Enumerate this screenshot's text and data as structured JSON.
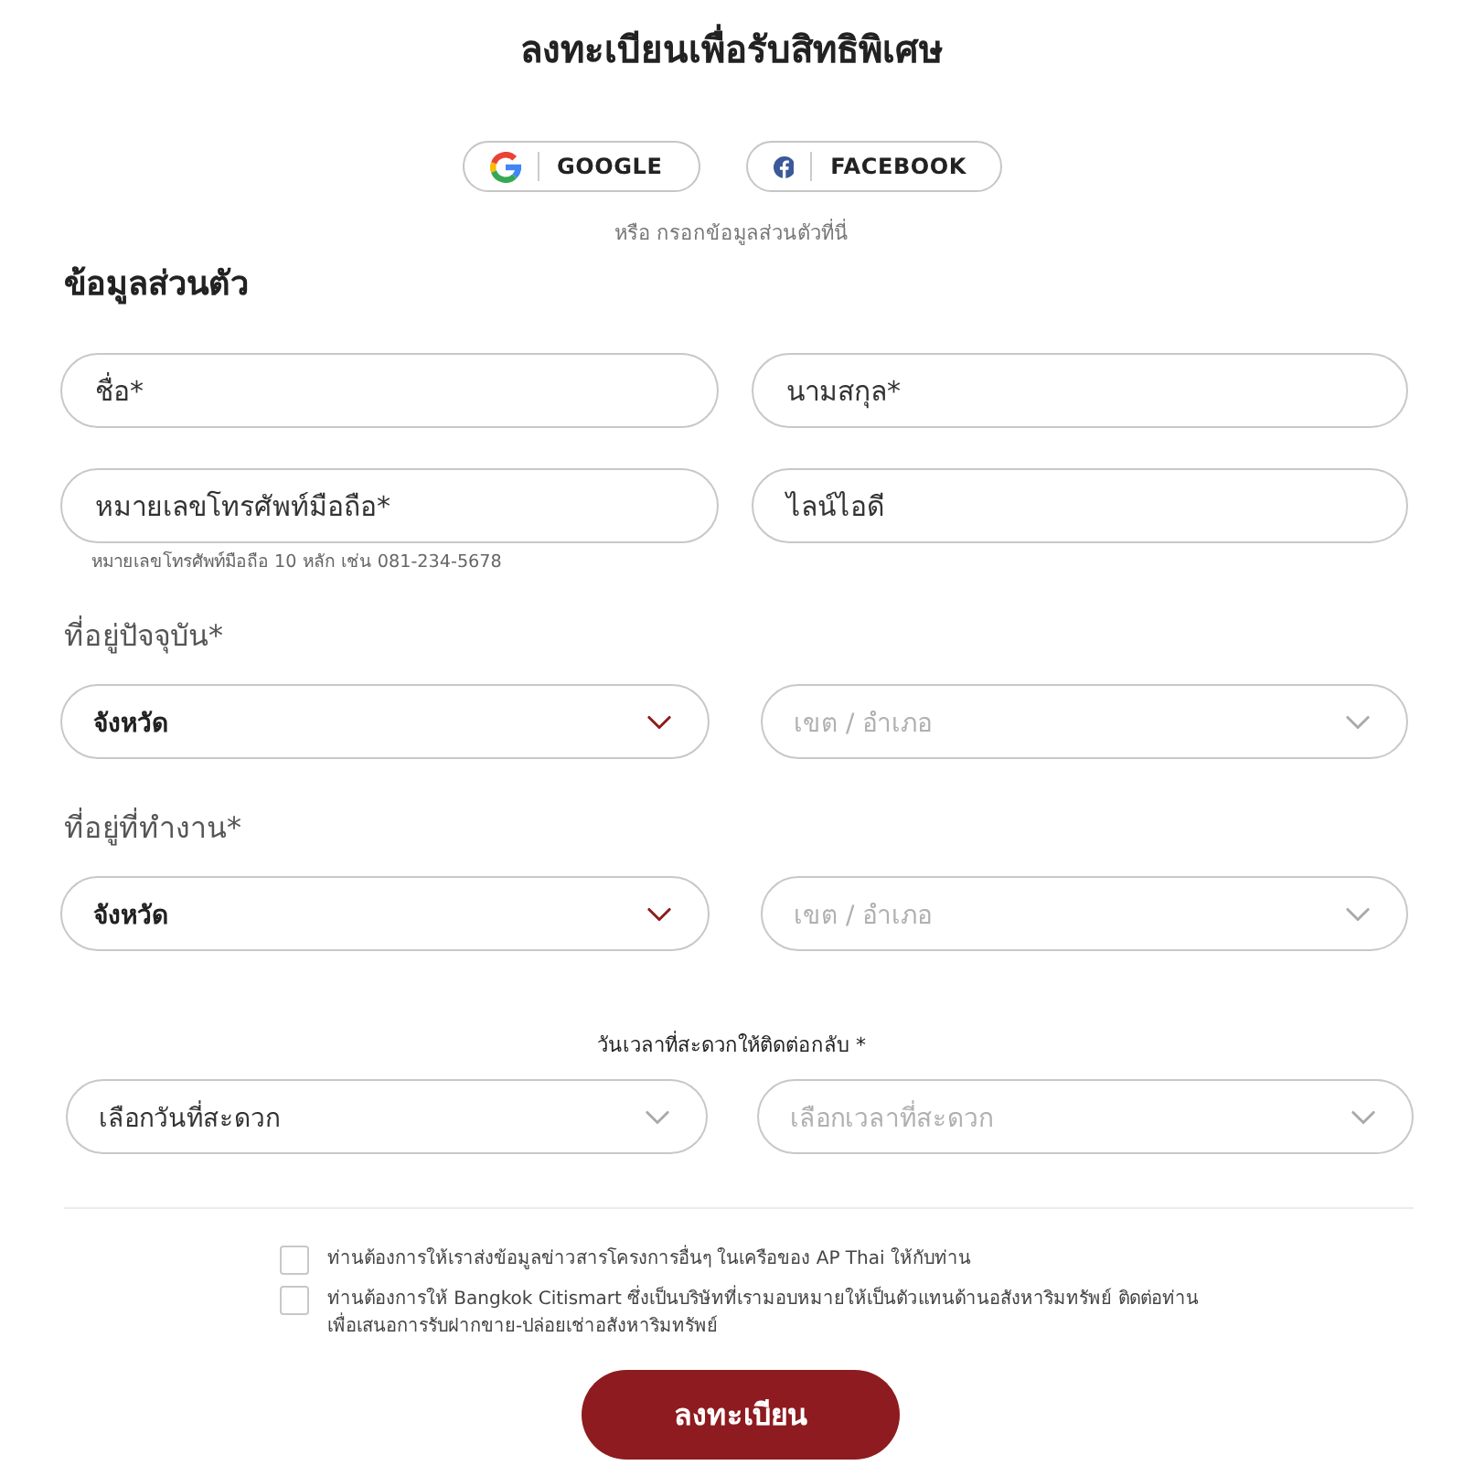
{
  "title": "ลงทะเบียนเพื่อรับสิทธิพิเศษ",
  "social_buttons": [
    {
      "kind": "google",
      "label": "GOOGLE"
    },
    {
      "kind": "facebook",
      "label": "FACEBOOK"
    }
  ],
  "divider_text": "หรือ กรอกข้อมูลส่วนตัวที่นี่",
  "personal_info": {
    "heading": "ข้อมูลส่วนตัว",
    "fields": [
      {
        "placeholder": "ชื่อ*"
      },
      {
        "placeholder": "นามสกุล*"
      },
      {
        "placeholder": "หมายเลขโทรศัพท์มือถือ*",
        "hint": "หมายเลขโทรศัพท์มือถือ 10 หลัก เช่น 081-234-5678"
      },
      {
        "placeholder": "ไลน์ไอดี"
      }
    ]
  },
  "addresses": [
    {
      "label": "ที่อยู่ปัจจุบัน*",
      "selects": [
        {
          "text": "จังหวัด",
          "disabled": false
        },
        {
          "text": "เขต / อำเภอ",
          "disabled": true
        }
      ]
    },
    {
      "label": "ที่อยู่ที่ทำงาน*",
      "selects": [
        {
          "text": "จังหวัด",
          "disabled": false
        },
        {
          "text": "เขต / อำเภอ",
          "disabled": true
        }
      ]
    }
  ],
  "contact_time": {
    "label": "วันเวลาที่สะดวกให้ติดต่อกลับ *",
    "selects": [
      {
        "text": "เลือกวันที่สะดวก",
        "disabled": false
      },
      {
        "text": "เลือกเวลาที่สะดวก",
        "disabled": true
      }
    ]
  },
  "consents": [
    {
      "label": "ท่านต้องการให้เราส่งข้อมูลข่าวสารโครงการอื่นๆ ในเครือของ AP Thai ให้กับท่าน",
      "checked": false
    },
    {
      "label": "ท่านต้องการให้ Bangkok Citismart ซึ่งเป็นบริษัทที่เรามอบหมายให้เป็นตัวแทนด้านอสังหาริมทรัพย์ ติดต่อท่านเพื่อเสนอการรับฝากขาย-ปล่อยเช่าอสังหาริมทรัพย์",
      "checked": false
    }
  ],
  "submit_button": "ลงทะเบียน"
}
